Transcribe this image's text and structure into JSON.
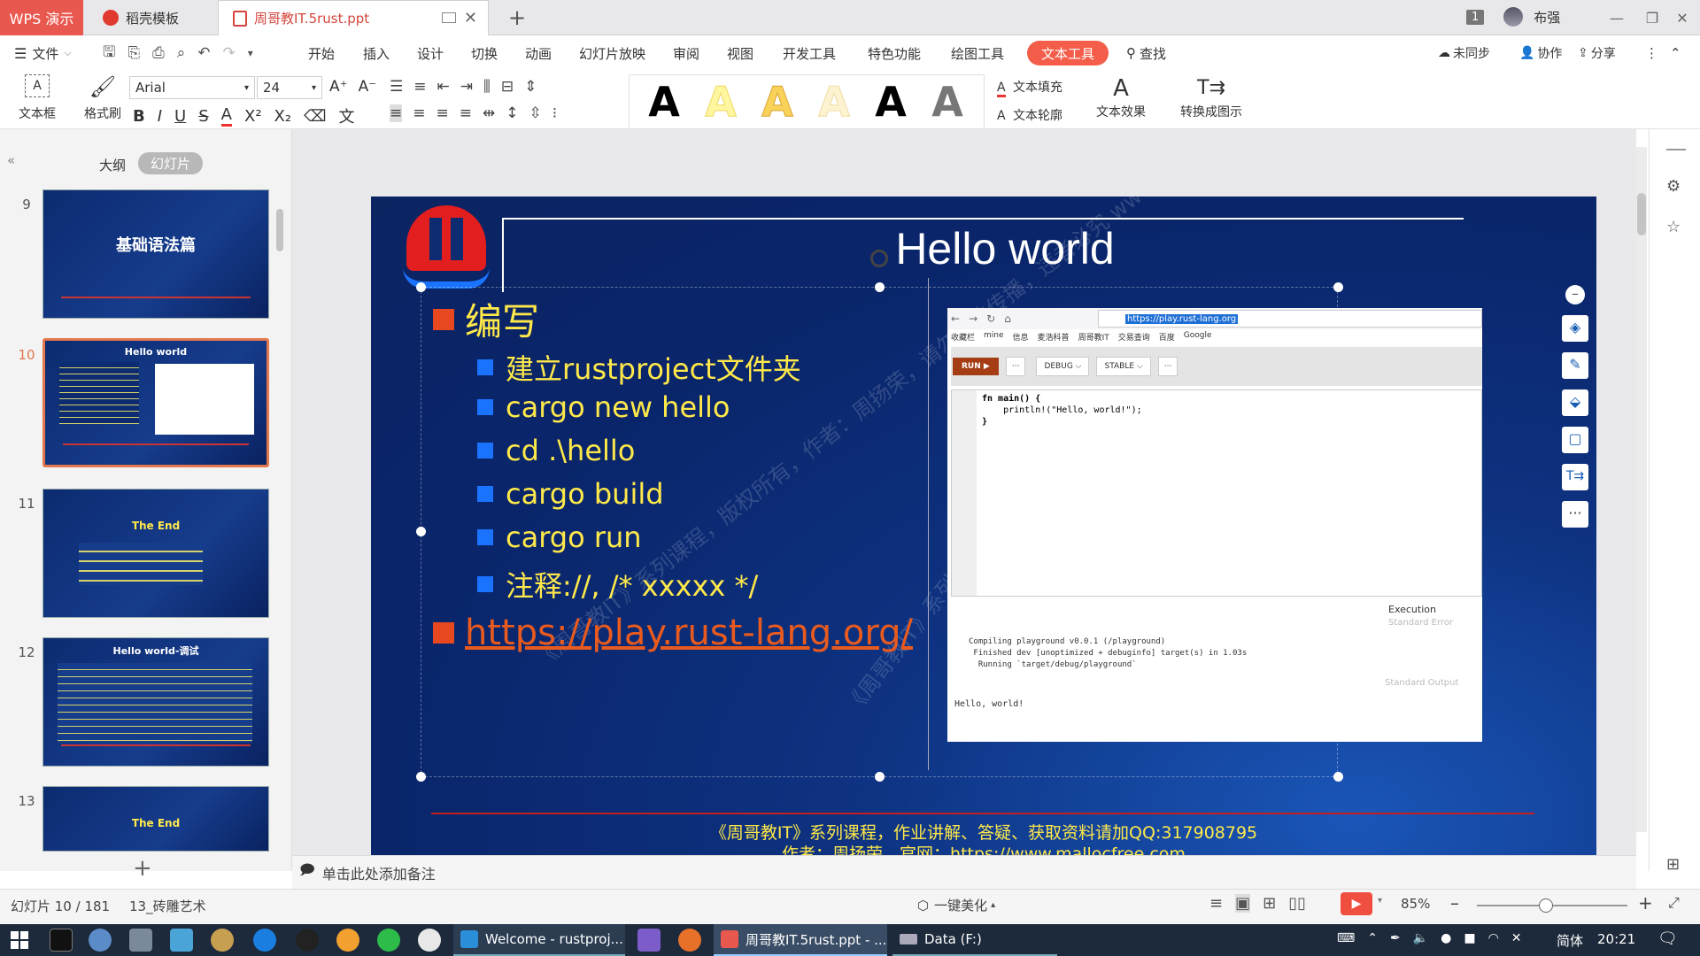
{
  "titlebar": {
    "app_name": "WPS 演示",
    "tabs": [
      {
        "label": "稻壳模板"
      },
      {
        "label": "周哥教IT.5rust.ppt"
      }
    ],
    "page_indicator": "1",
    "user_name": "布强"
  },
  "menubar": {
    "file_label": "文件",
    "items": [
      "开始",
      "插入",
      "设计",
      "切换",
      "动画",
      "幻灯片放映",
      "审阅",
      "视图",
      "开发工具",
      "特色功能",
      "绘图工具",
      "文本工具"
    ],
    "search_label": "查找",
    "sync_label": "未同步",
    "collab_label": "协作",
    "share_label": "分享"
  },
  "ribbon": {
    "textbox_label": "文本框",
    "format_painter_label": "格式刷",
    "font_name": "Arial",
    "font_size": "24",
    "text_fill_label": "文本填充",
    "text_outline_label": "文本轮廓",
    "text_effect_label": "文本效果",
    "convert_label": "转换成图示",
    "style_letter": "A"
  },
  "leftpanel": {
    "tab_outline": "大纲",
    "tab_slides": "幻灯片",
    "thumbs": [
      {
        "num": "9",
        "title": "基础语法篇"
      },
      {
        "num": "10",
        "title": "Hello world"
      },
      {
        "num": "11",
        "title": "The End"
      },
      {
        "num": "12",
        "title": "Hello world-调试"
      },
      {
        "num": "13",
        "title": "The End"
      }
    ]
  },
  "slide": {
    "title": "Hello world",
    "heading": "编写",
    "bullets": [
      "建立rustproject文件夹",
      "cargo new hello",
      "cd .\\hello",
      "cargo build",
      "cargo run",
      "注释://, /* xxxxx */"
    ],
    "link": "https://play.rust-lang.org/",
    "footer_line1": "《周哥教IT》系列课程，作业讲解、答疑、获取资料请加QQ:317908795",
    "footer_line2": "作者：周扬荣，官网：https://www.mallocfree.com",
    "watermark1": "《周哥教IT》系列课程，版权所有，作者：周扬荣，请勿非法传播，违者必究  www.mallocfree.com",
    "watermark2": "《周哥教IT》系列，版权所有"
  },
  "browser": {
    "url": "https://play.rust-lang.org",
    "bookmarks": [
      "收藏栏",
      "mine",
      "信息",
      "麦浩科普",
      "周哥教IT",
      "交易查询",
      "百度",
      "Google"
    ],
    "run_label": "RUN",
    "debug_label": "DEBUG",
    "stable_label": "STABLE",
    "more_label": "···",
    "code_lines": [
      "fn main() {",
      "    println!(\"Hello, world!\");",
      "}"
    ],
    "execution_label": "Execution",
    "stderr_label": "Standard Error",
    "stdout_label": "Standard Output",
    "compile_lines": [
      "Compiling playground v0.0.1 (/playground)",
      " Finished dev [unoptimized + debuginfo] target(s) in 1.03s",
      "  Running `target/debug/playground`"
    ],
    "output": "Hello, world!"
  },
  "notes_placeholder": "单击此处添加备注",
  "statusbar": {
    "slide_counter": "幻灯片 10 / 181",
    "theme": "13_砖雕艺术",
    "beautify": "一键美化",
    "zoom": "85%"
  },
  "taskbar": {
    "items": [
      "Welcome - rustproj...",
      "周哥教IT.5rust.ppt - ...",
      "Data (F:)"
    ],
    "ime": "简体",
    "time": "20:21"
  },
  "colors": {
    "accent": "#f35d4a",
    "slide_bg": "#0e3382",
    "bullet_text": "#ffe94a",
    "bullet_square": "#1a73ff",
    "heading_square": "#e8481f",
    "link": "#e85a1e"
  }
}
